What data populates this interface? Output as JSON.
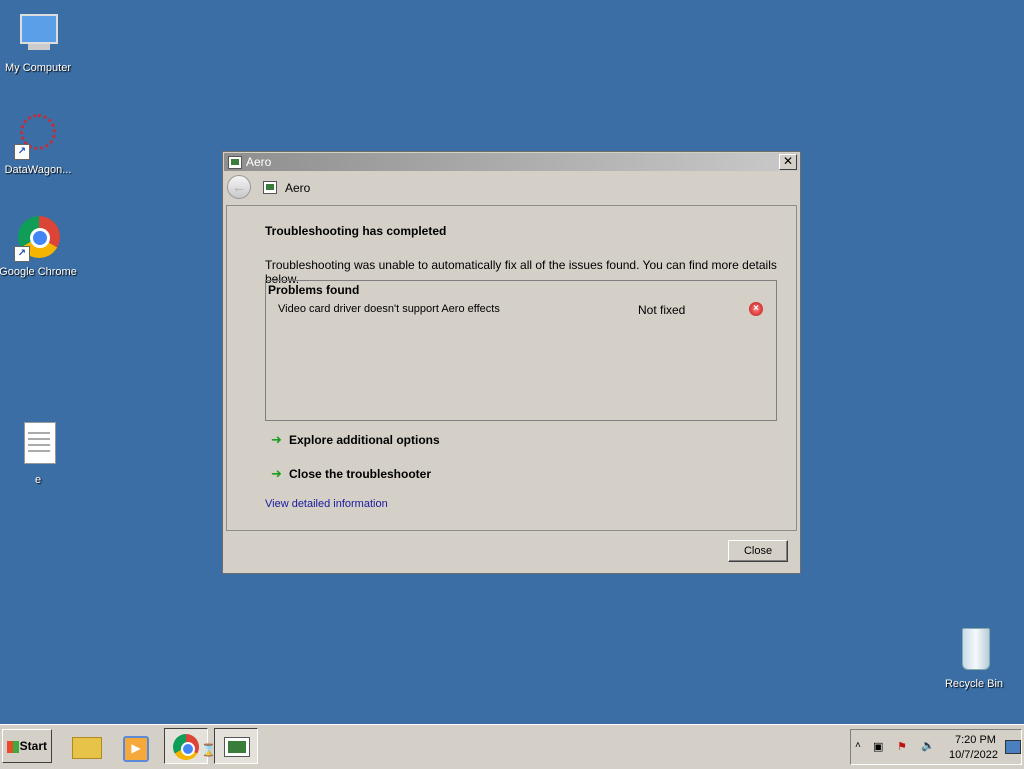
{
  "desktop": {
    "icons": [
      {
        "label": "My Computer"
      },
      {
        "label": "DataWagon..."
      },
      {
        "label": "Google Chrome"
      },
      {
        "label": "e"
      },
      {
        "label": "Recycle Bin"
      }
    ]
  },
  "dialog": {
    "title": "Aero",
    "nav_title": "Aero",
    "close_glyph": "✕",
    "heading": "Troubleshooting has completed",
    "message": "Troubleshooting was unable to automatically fix all of the issues found. You can find more details below.",
    "problems": {
      "header": "Problems found",
      "items": [
        {
          "name": "Video card driver doesn't support Aero effects",
          "status": "Not fixed",
          "status_icon": "error-icon"
        }
      ]
    },
    "options": [
      {
        "label": "Explore additional options"
      },
      {
        "label": "Close the troubleshooter"
      }
    ],
    "detail_link": "View detailed information",
    "close_button": "Close"
  },
  "taskbar": {
    "start_label": "Start",
    "apps": [
      "explorer-icon",
      "media-player-icon",
      "chrome-icon",
      "aero-troubleshooter-icon"
    ],
    "clock": {
      "time": "7:20 PM",
      "date": "10/7/2022"
    }
  },
  "colors": {
    "desktop": "#3a6ea5",
    "window": "#d4d0c8",
    "link": "#1a1a9c",
    "option_arrow": "#1f9b1f",
    "error": "#c01010"
  }
}
